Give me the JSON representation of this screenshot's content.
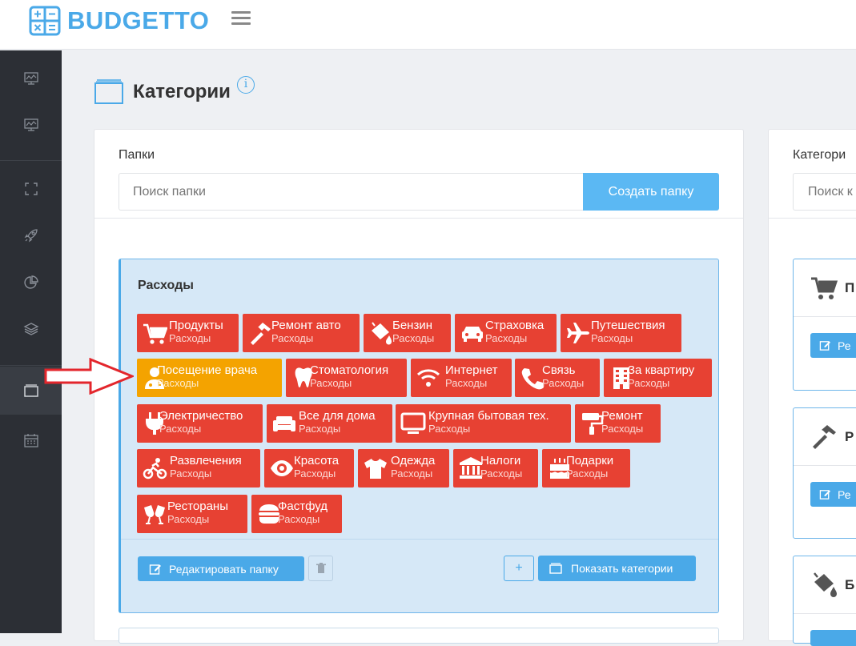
{
  "app": {
    "brand": "BUDGETTO"
  },
  "page": {
    "title": "Категории",
    "info": "i"
  },
  "sidebar": {
    "items": [
      {
        "icon": "presentation-chart-icon"
      },
      {
        "icon": "presentation-chart-icon"
      },
      {
        "icon": "expand-icon"
      },
      {
        "icon": "rocket-icon"
      },
      {
        "icon": "pie-chart-icon"
      },
      {
        "icon": "layers-icon"
      },
      {
        "icon": "folder-icon",
        "active": true
      },
      {
        "icon": "calendar-icon"
      }
    ]
  },
  "folders_panel": {
    "label": "Папки",
    "search_placeholder": "Поиск папки",
    "create_button": "Создать папку",
    "folder": {
      "name": "Расходы",
      "tags": [
        {
          "name": "Продукты",
          "folder": "Расходы",
          "icon": "cart-icon"
        },
        {
          "name": "Ремонт авто",
          "folder": "Расходы",
          "icon": "hammer-icon"
        },
        {
          "name": "Бензин",
          "folder": "Расходы",
          "icon": "paint-bucket-icon"
        },
        {
          "name": "Страховка",
          "folder": "Расходы",
          "icon": "car-icon"
        },
        {
          "name": "Путешествия",
          "folder": "Расходы",
          "icon": "plane-icon"
        },
        {
          "name": "Посещение врача",
          "folder": "Расходы",
          "icon": "doctor-icon",
          "selected": true
        },
        {
          "name": "Стоматология",
          "folder": "Расходы",
          "icon": "tooth-icon"
        },
        {
          "name": "Интернет",
          "folder": "Расходы",
          "icon": "wifi-icon"
        },
        {
          "name": "Связь",
          "folder": "Расходы",
          "icon": "phone-icon"
        },
        {
          "name": "За квартиру",
          "folder": "Расходы",
          "icon": "building-icon"
        },
        {
          "name": "Электричество",
          "folder": "Расходы",
          "icon": "plug-icon"
        },
        {
          "name": "Все для дома",
          "folder": "Расходы",
          "icon": "sofa-icon"
        },
        {
          "name": "Крупная бытовая тех.",
          "folder": "Расходы",
          "icon": "tv-icon"
        },
        {
          "name": "Ремонт",
          "folder": "Расходы",
          "icon": "paint-roller-icon"
        },
        {
          "name": "Развлечения",
          "folder": "Расходы",
          "icon": "bike-icon"
        },
        {
          "name": "Красота",
          "folder": "Расходы",
          "icon": "eye-icon"
        },
        {
          "name": "Одежда",
          "folder": "Расходы",
          "icon": "tshirt-icon"
        },
        {
          "name": "Налоги",
          "folder": "Расходы",
          "icon": "bank-icon"
        },
        {
          "name": "Подарки",
          "folder": "Расходы",
          "icon": "cake-icon"
        },
        {
          "name": "Рестораны",
          "folder": "Расходы",
          "icon": "glasses-cheers-icon"
        },
        {
          "name": "Фастфуд",
          "folder": "Расходы",
          "icon": "burger-icon"
        }
      ],
      "edit_button": "Редактировать папку",
      "add_button": "+",
      "show_button": "Показать категории"
    }
  },
  "categories_panel": {
    "label": "Категори",
    "search_placeholder": "Поиск к",
    "cards": [
      {
        "name": "П",
        "button": "Ре",
        "icon": "cart-icon"
      },
      {
        "name": "Р",
        "button": "Ре",
        "icon": "hammer-icon"
      },
      {
        "name": "Б",
        "icon": "paint-bucket-icon"
      }
    ]
  },
  "colors": {
    "accent": "#4aa9e8",
    "tag": "#e74133",
    "tag_selected": "#f4a300",
    "sidebar": "#2c2f35",
    "annotation_arrow": "#e3262c"
  }
}
